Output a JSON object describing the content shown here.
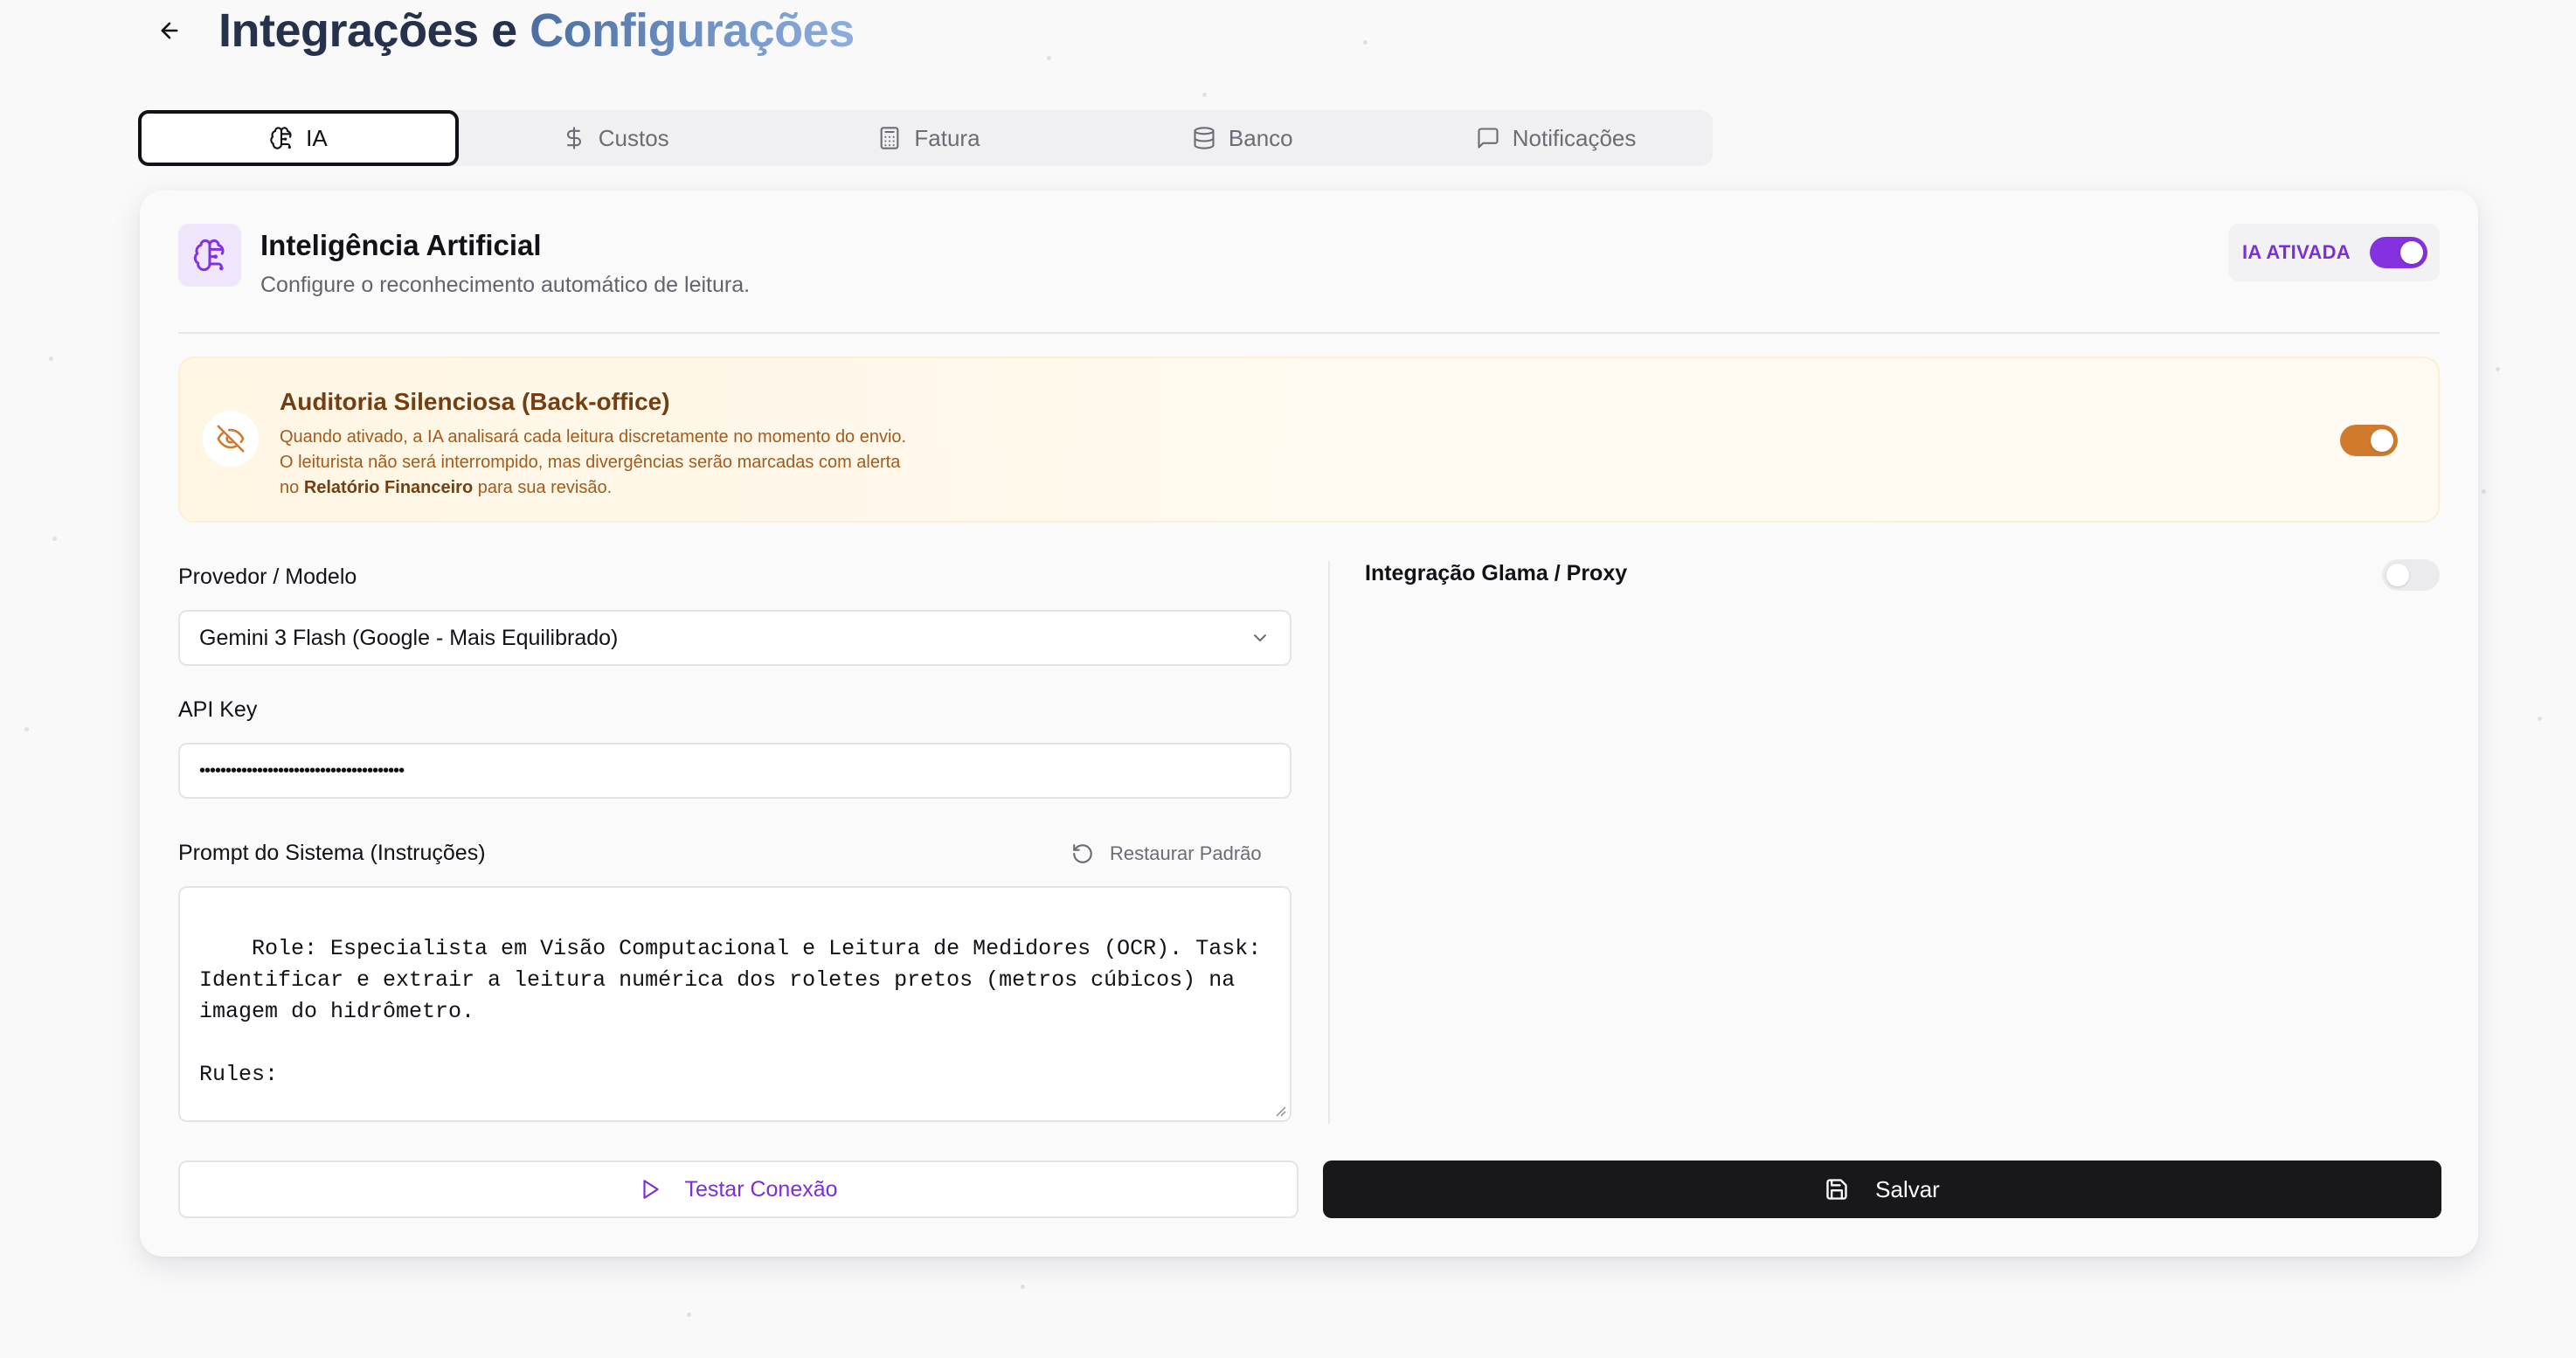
{
  "header": {
    "title_part1": "Integrações e",
    "title_part2": "Configurações"
  },
  "tabs": [
    {
      "label": "IA",
      "icon": "brain-icon",
      "active": true
    },
    {
      "label": "Custos",
      "icon": "dollar-icon",
      "active": false
    },
    {
      "label": "Fatura",
      "icon": "calculator-icon",
      "active": false
    },
    {
      "label": "Banco",
      "icon": "database-icon",
      "active": false
    },
    {
      "label": "Notificações",
      "icon": "message-icon",
      "active": false
    }
  ],
  "card": {
    "title": "Inteligência Artificial",
    "subtitle": "Configure o reconhecimento automático de leitura.",
    "ai_toggle_label": "IA ATIVADA",
    "ai_toggle_on": true
  },
  "audit": {
    "title": "Auditoria Silenciosa (Back-office)",
    "line1": "Quando ativado, a IA analisará cada leitura discretamente no momento do envio.",
    "line2": "O leiturista não será interrompido, mas divergências serão marcadas com alerta",
    "line3_prefix": "no",
    "line3_bold": "Relatório Financeiro",
    "line3_suffix": "para sua revisão.",
    "toggle_on": true
  },
  "form": {
    "provider_label": "Provedor / Modelo",
    "provider_value": "Gemini 3 Flash (Google - Mais Equilibrado)",
    "api_key_label": "API Key",
    "api_key_value": "•••••••••••••••••••••••••••••••••••••••",
    "prompt_label": "Prompt do Sistema (Instruções)",
    "restore_label": "Restaurar Padrão",
    "prompt_value": "Role: Especialista em Visão Computacional e Leitura de Medidores (OCR). Task: Identificar e extrair a leitura numérica dos roletes pretos (metros cúbicos) na imagem do hidrômetro.\n\nRules:\n\nFoco Seletivo: Ignore dígitos vermelhos ou ponteiros circulares. Identifique"
  },
  "glama": {
    "label": "Integração Glama / Proxy",
    "toggle_on": false
  },
  "actions": {
    "test_label": "Testar Conexão",
    "save_label": "Salvar"
  },
  "colors": {
    "accent_purple": "#8431e0",
    "audit_orange": "#d17a2d",
    "save_bg": "#18181b"
  }
}
